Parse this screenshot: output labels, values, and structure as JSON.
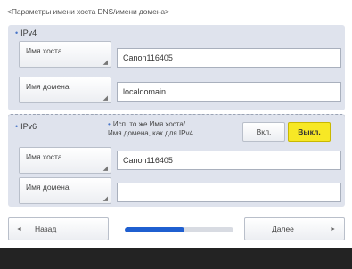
{
  "title": "<Параметры имени хоста DNS/имени домена>",
  "ipv4": {
    "section_label": "IPv4",
    "hostname_label": "Имя хоста",
    "hostname_value": "Canon116405",
    "domain_label": "Имя домена",
    "domain_value": "localdomain"
  },
  "ipv6": {
    "section_label": "IPv6",
    "same_as_note_line1": "Исп. то же Имя хоста/",
    "same_as_note_line2": "Имя домена, как для IPv4",
    "on_label": "Вкл.",
    "off_label": "Выкл.",
    "selected": "off",
    "hostname_label": "Имя хоста",
    "hostname_value": "Canon116405",
    "domain_label": "Имя домена",
    "domain_value": ""
  },
  "nav": {
    "back_label": "Назад",
    "next_label": "Далее",
    "progress_fraction": 0.55
  },
  "colors": {
    "accent": "#1f5fd0",
    "selected_toggle": "#f7e825",
    "section_bg": "#dfe3ed",
    "status_bar": "#232323"
  }
}
